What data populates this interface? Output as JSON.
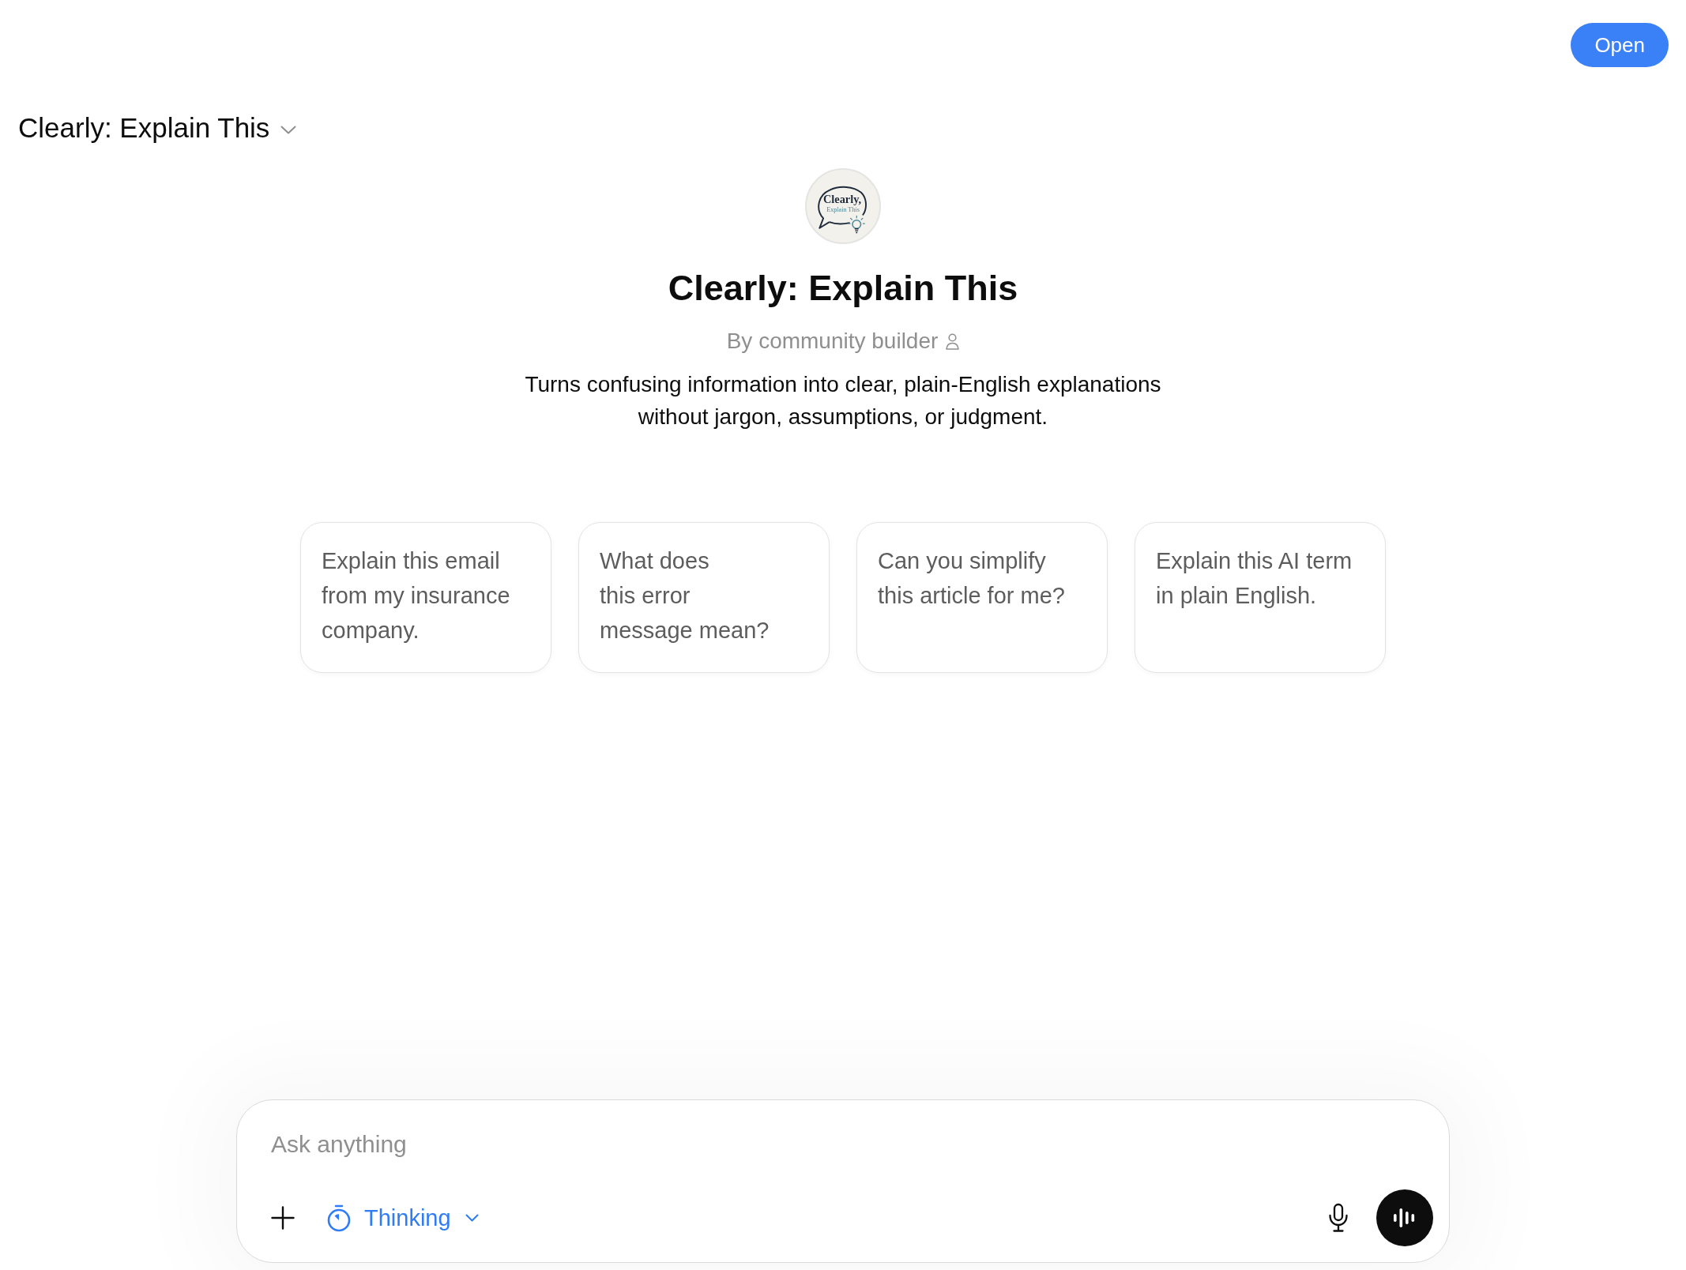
{
  "header": {
    "open_button": "Open"
  },
  "gpt_menu": {
    "title": "Clearly: Explain This"
  },
  "profile": {
    "logo_text": [
      "Clearly,",
      "Explain This"
    ],
    "name": "Clearly: Explain This",
    "byline": "By community builder",
    "description": "Turns confusing information into clear, plain-English explanations without jargon, assumptions, or judgment."
  },
  "starters": [
    "Explain this email from my insurance company.",
    "What does\nthis error\nmessage mean?",
    "Can you simplify this article for me?",
    "Explain this AI term in plain English."
  ],
  "composer": {
    "placeholder": "Ask anything",
    "mode": "Thinking"
  }
}
